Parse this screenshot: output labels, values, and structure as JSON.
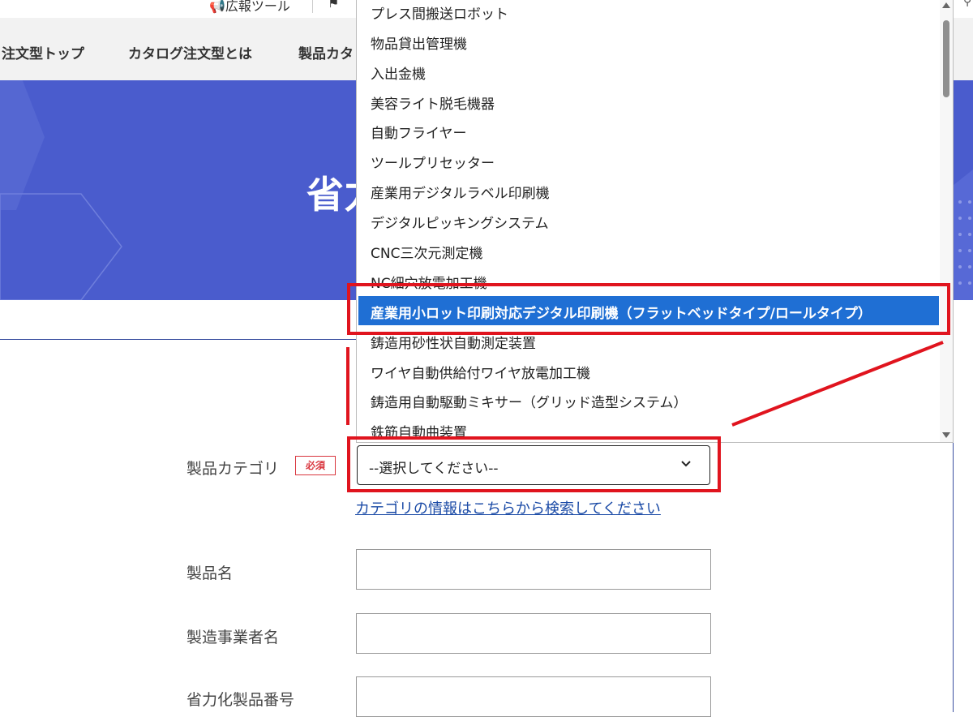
{
  "topbar": {
    "links": [
      "広報ツール"
    ]
  },
  "nav": {
    "items": [
      "注文型トップ",
      "カタログ注文型とは",
      "製品カタ"
    ]
  },
  "hero": {
    "title": "省力"
  },
  "form": {
    "category_label": "製品カテゴリ",
    "required_badge": "必須",
    "select_value": "--選択してください--",
    "category_link": "カテゴリの情報はこちらから検索してください",
    "product_name_label": "製品名",
    "manufacturer_label": "製造事業者名",
    "product_number_label": "省力化製品番号"
  },
  "dropdown": {
    "options": [
      "プレス間搬送ロボット",
      "物品貸出管理機",
      "入出金機",
      "美容ライト脱毛機器",
      "自動フライヤー",
      "ツールプリセッター",
      "産業用デジタルラベル印刷機",
      "デジタルピッキングシステム",
      "CNC三次元測定機",
      "NC細穴放電加工機"
    ],
    "selected_option": "産業用小ロット印刷対応デジタル印刷機（フラットベッドタイプ/ロールタイプ）",
    "options_after": [
      "鋳造用砂性状自動測定装置",
      "ワイヤ自動供給付ワイヤ放電加工機",
      "鋳造用自動駆動ミキサー（グリッド造型システム）",
      "鉄筋自動曲装置"
    ]
  },
  "colors": {
    "hero_bg": "#4a5ccd",
    "highlight": "#1f6fd4",
    "annotation": "#e0141e",
    "link": "#1a4aa6",
    "required": "#d9363e"
  }
}
